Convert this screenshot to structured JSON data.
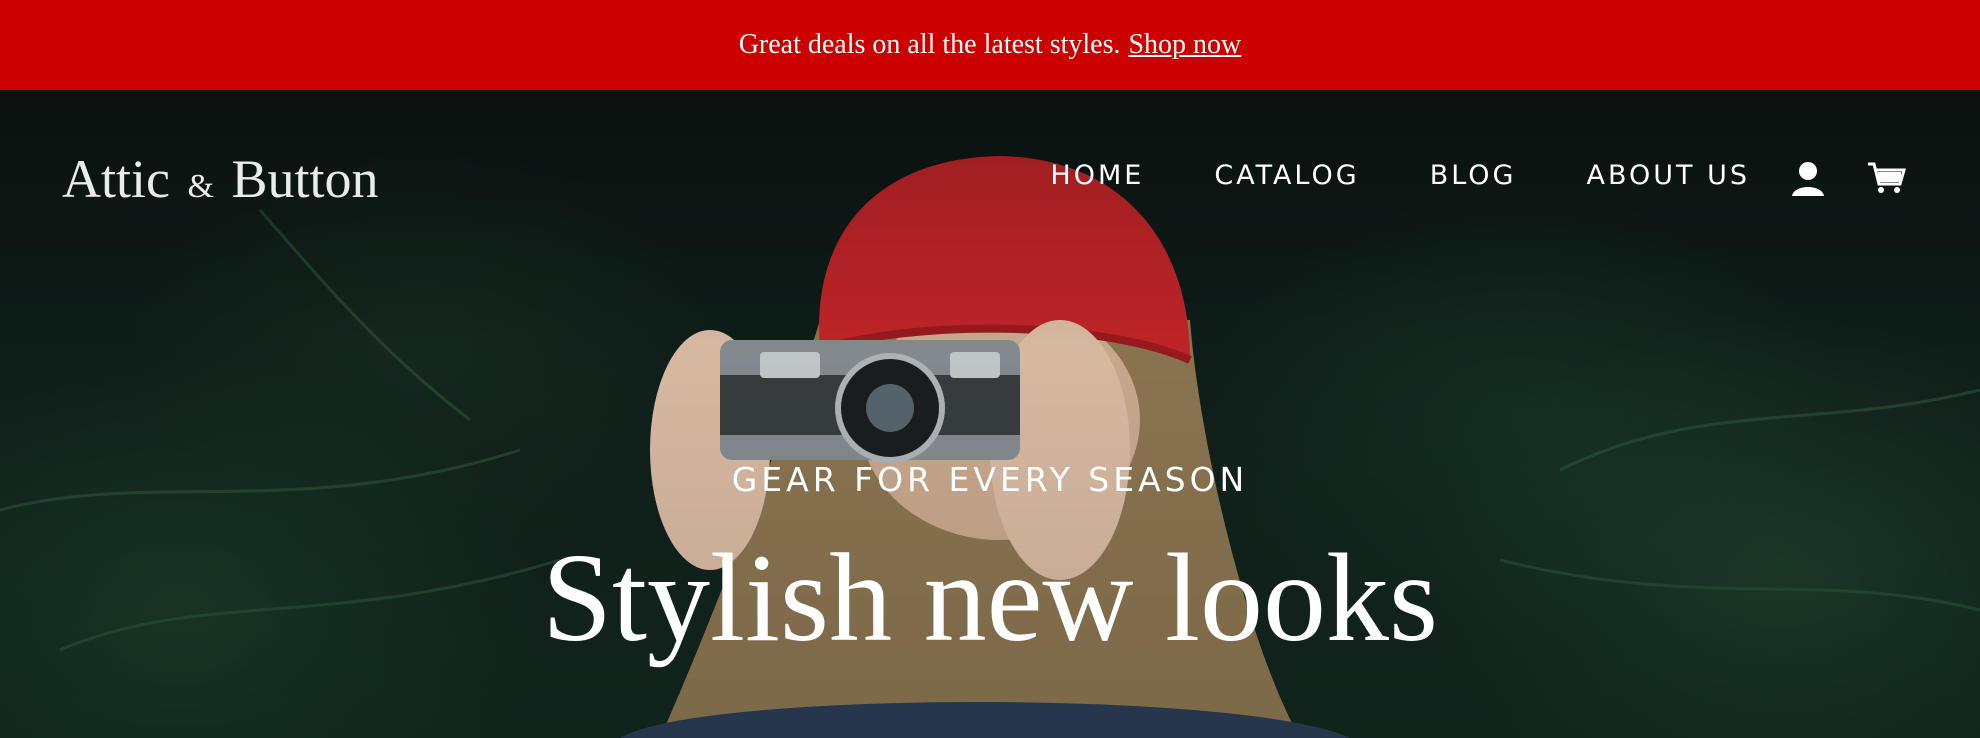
{
  "announcement": {
    "text": "Great deals on all the latest styles.",
    "link_label": "Shop now",
    "background": "#cc0000"
  },
  "header": {
    "logo_main": "Attic",
    "logo_amp": "&",
    "logo_end": "Button",
    "nav": [
      {
        "label": "HOME"
      },
      {
        "label": "CATALOG"
      },
      {
        "label": "BLOG"
      },
      {
        "label": "ABOUT US"
      }
    ],
    "icons": [
      "account-icon",
      "cart-icon"
    ]
  },
  "hero": {
    "eyebrow": "GEAR FOR EVERY SEASON",
    "headline": "Stylish new looks"
  }
}
